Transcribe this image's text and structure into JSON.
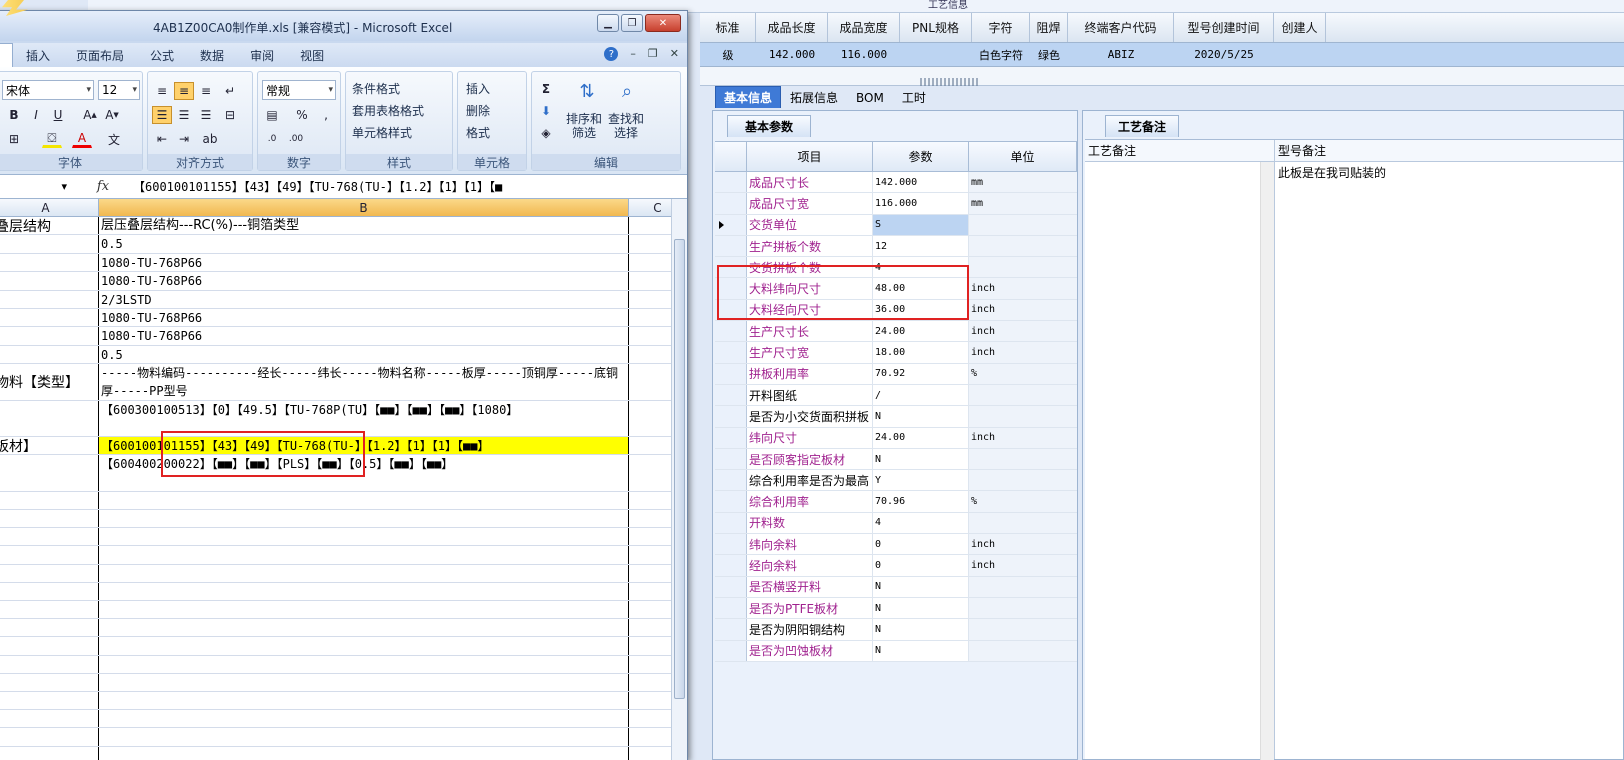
{
  "app": {
    "top_strip_text": "工艺信息",
    "grid_headers": [
      "标准",
      "成品长度",
      "成品宽度",
      "PNL规格",
      "字符",
      "阻焊",
      "终端客户代码",
      "型号创建时间",
      "创建人"
    ],
    "grid_row": [
      "级",
      "142.000",
      "116.000",
      "",
      "白色字符",
      "绿色",
      "ABIZ",
      "2020/5/25",
      ""
    ],
    "tabs": [
      "基本信息",
      "拓展信息",
      "BOM",
      "工时"
    ],
    "left_panel_title": "基本参数",
    "param_headers": [
      "项目",
      "参数",
      "单位"
    ],
    "params": [
      {
        "name": "成品尺寸长",
        "value": "142.000",
        "unit": "mm",
        "purple": true
      },
      {
        "name": "成品尺寸宽",
        "value": "116.000",
        "unit": "mm",
        "purple": true
      },
      {
        "name": "交货单位",
        "value": "S",
        "unit": "",
        "purple": true,
        "current": true
      },
      {
        "name": "生产拼板个数",
        "value": "12",
        "unit": "",
        "purple": true
      },
      {
        "name": "交货拼板个数",
        "value": "4",
        "unit": "",
        "purple": true
      },
      {
        "name": "大料纬向尺寸",
        "value": "48.00",
        "unit": "inch",
        "purple": true
      },
      {
        "name": "大料经向尺寸",
        "value": "36.00",
        "unit": "inch",
        "purple": true
      },
      {
        "name": "生产尺寸长",
        "value": "24.00",
        "unit": "inch",
        "purple": true
      },
      {
        "name": "生产尺寸宽",
        "value": "18.00",
        "unit": "inch",
        "purple": true
      },
      {
        "name": "拼板利用率",
        "value": "70.92",
        "unit": "%",
        "purple": true
      },
      {
        "name": "开料图纸",
        "value": "/",
        "unit": "",
        "purple": false
      },
      {
        "name": "是否为小交货面积拼板",
        "value": "N",
        "unit": "",
        "purple": false
      },
      {
        "name": "纬向尺寸",
        "value": "24.00",
        "unit": "inch",
        "purple": true
      },
      {
        "name": "是否顾客指定板材",
        "value": "N",
        "unit": "",
        "purple": true
      },
      {
        "name": "综合利用率是否为最高",
        "value": "Y",
        "unit": "",
        "purple": false
      },
      {
        "name": "综合利用率",
        "value": "70.96",
        "unit": "%",
        "purple": true
      },
      {
        "name": "开料数",
        "value": "4",
        "unit": "",
        "purple": true
      },
      {
        "name": "纬向余料",
        "value": "0",
        "unit": "inch",
        "purple": true
      },
      {
        "name": "经向余料",
        "value": "0",
        "unit": "inch",
        "purple": true
      },
      {
        "name": "是否横竖开料",
        "value": "N",
        "unit": "",
        "purple": true
      },
      {
        "name": "是否为PTFE板材",
        "value": "N",
        "unit": "",
        "purple": true
      },
      {
        "name": "是否为阴阳铜结构",
        "value": "N",
        "unit": "",
        "purple": false
      },
      {
        "name": "是否为凹蚀板材",
        "value": "N",
        "unit": "",
        "purple": true
      }
    ],
    "right_panel_title": "工艺备注",
    "remark_headers": [
      "工艺备注",
      "型号备注"
    ],
    "model_remark": "此板是在我司贴装的"
  },
  "excel": {
    "title": "4AB1Z00CA0制作单.xls  [兼容模式] - Microsoft Excel",
    "menu": [
      "",
      "插入",
      "页面布局",
      "公式",
      "数据",
      "审阅",
      "视图"
    ],
    "font_name": "宋体",
    "font_size": "12",
    "number_format": "常规",
    "styles": [
      "条件格式",
      "套用表格格式",
      "单元格样式"
    ],
    "cells_buttons": [
      "插入",
      "删除",
      "格式"
    ],
    "edit_buttons": [
      "排序和\n筛选",
      "查找和\n选择"
    ],
    "group_labels": [
      "字体",
      "对齐方式",
      "数字",
      "样式",
      "单元格",
      "编辑"
    ],
    "formula": "【600100101155】【43】【49】【TU-768(TU-】【1.2】【1】【1】【■",
    "col_headers": [
      "A",
      "B",
      "C"
    ],
    "rows": [
      {
        "a": "叠层结构",
        "b": "层压叠层结构---RC(%)---铜箔类型",
        "h": 18,
        "header": true
      },
      {
        "a": "",
        "b": "0.5",
        "h": 18
      },
      {
        "a": "",
        "b": "1080-TU-768P66",
        "h": 18
      },
      {
        "a": "",
        "b": "1080-TU-768P66",
        "h": 18
      },
      {
        "a": "",
        "b": "2/3LSTD",
        "h": 18
      },
      {
        "a": "",
        "b": "1080-TU-768P66",
        "h": 18
      },
      {
        "a": "",
        "b": "1080-TU-768P66",
        "h": 18
      },
      {
        "a": "",
        "b": "0.5",
        "h": 18
      },
      {
        "a": "物料【类型】",
        "b": "-----物料编码----------经长-----纬长-----物料名称-----板厚-----顶铜厚-----底铜厚-----PP型号",
        "h": 36
      },
      {
        "a": "】",
        "b": "【600300100513】【0】【49.5】【TU-768P(TU】【■■】【■■】【■■】【1080】",
        "h": 36
      },
      {
        "a": "板材】",
        "b": "【600100101155】【43】【49】【TU-768(TU-】【1.2】【1】【1】【■■】",
        "h": 18,
        "highlight": true
      },
      {
        "a": "】",
        "b": "【600400200022】【■■】【■■】【PLS】【■■】【0.5】【■■】【■■】",
        "h": 36
      }
    ]
  }
}
